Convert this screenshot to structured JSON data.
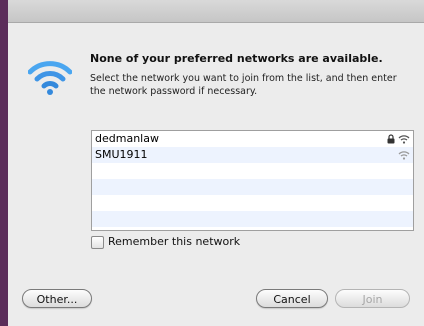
{
  "dialog": {
    "title": "None of your preferred networks are available.",
    "description": "Select the network you want to join from the list, and then enter the network password if necessary.",
    "icon": "wifi-icon"
  },
  "networks": [
    {
      "name": "dedmanlaw",
      "secured": true
    },
    {
      "name": "SMU1911",
      "secured": false
    }
  ],
  "remember": {
    "label": "Remember this network",
    "checked": false
  },
  "buttons": {
    "other": "Other...",
    "cancel": "Cancel",
    "join": "Join"
  },
  "colors": {
    "wifi_blue": "#3f95e6",
    "row_alt": "#edf3fe",
    "window_bg": "#ececec"
  }
}
